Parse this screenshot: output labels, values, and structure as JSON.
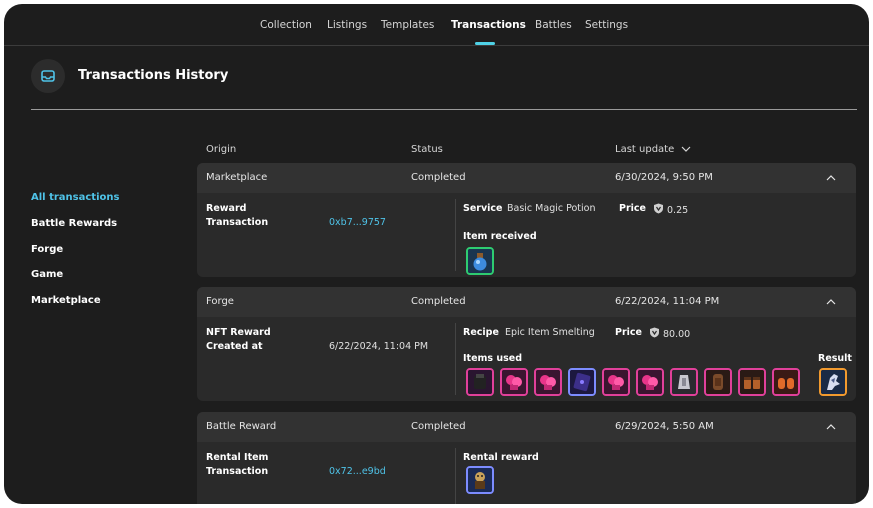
{
  "nav": {
    "tabs": [
      "Collection",
      "Listings",
      "Templates",
      "Transactions",
      "Battles",
      "Settings"
    ],
    "active": "Transactions"
  },
  "page": {
    "title": "Transactions History",
    "icon": "inbox-icon"
  },
  "sidebar": {
    "items": [
      "All transactions",
      "Battle Rewards",
      "Forge",
      "Game",
      "Marketplace"
    ],
    "active": "All transactions"
  },
  "columns": {
    "origin": "Origin",
    "status": "Status",
    "last_update": "Last update"
  },
  "colors": {
    "accent": "#4fc3e8",
    "background": "#1d1d1d",
    "card": "#2a2a2a",
    "card_header": "#323232"
  },
  "transactions": [
    {
      "origin": "Marketplace",
      "status": "Completed",
      "date": "6/30/2024, 9:50 PM",
      "left_label": "Reward\nTransaction",
      "left_label_1": "Reward",
      "left_label_2": "Transaction",
      "left_value": "0xb7...9757",
      "service_label": "Service",
      "service_value": "Basic Magic Potion",
      "price_label": "Price",
      "price_value": "0.25",
      "items_label": "Item received"
    },
    {
      "origin": "Forge",
      "status": "Completed",
      "date": "6/22/2024, 11:04 PM",
      "left_label_1": "NFT Reward",
      "left_label_2": "Created at",
      "left_value": "6/22/2024, 11:04 PM",
      "recipe_label": "Recipe",
      "recipe_value": "Epic Item Smelting",
      "price_label": "Price",
      "price_value": "80.00",
      "items_label": "Items used",
      "result_label": "Result"
    },
    {
      "origin": "Battle Reward",
      "status": "Completed",
      "date": "6/29/2024, 5:50 AM",
      "left_label_1": "Rental Item",
      "left_label_2": "Transaction",
      "left_value": "0x72...e9bd",
      "items_label": "Rental reward"
    }
  ]
}
